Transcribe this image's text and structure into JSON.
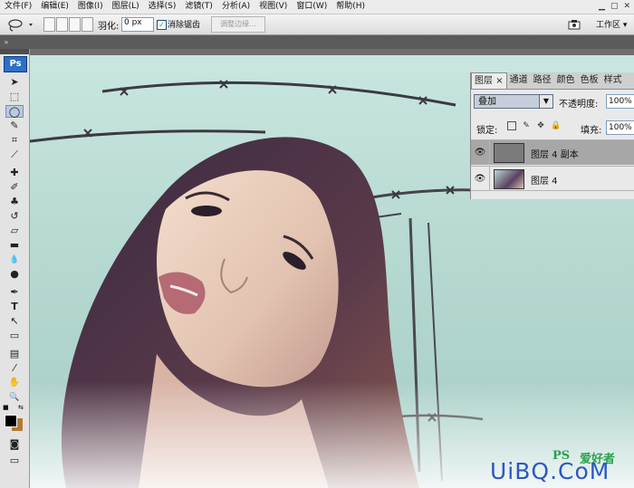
{
  "menu": {
    "items": [
      "文件(F)",
      "编辑(E)",
      "图像(I)",
      "图层(L)",
      "选择(S)",
      "滤镜(T)",
      "分析(A)",
      "视图(V)",
      "窗口(W)",
      "帮助(H)"
    ]
  },
  "options_bar": {
    "feather_label": "羽化:",
    "feather_value": "0 px",
    "antialias_label": "消除锯齿",
    "antialias_checked": true,
    "refine_edge_label": "调整边缘...",
    "workspace_label": "工作区 ▾"
  },
  "toolbox": {
    "logo": "Ps",
    "tools": [
      {
        "name": "move-tool",
        "glyph": "➤"
      },
      {
        "name": "marquee-tool",
        "glyph": "⬚"
      },
      {
        "name": "lasso-tool",
        "glyph": "◯",
        "active": true
      },
      {
        "name": "quick-select-tool",
        "glyph": "✎"
      },
      {
        "name": "crop-tool",
        "glyph": "⌗"
      },
      {
        "name": "eyedropper-tool",
        "glyph": "⟋"
      },
      {
        "name": "healing-tool",
        "glyph": "✚"
      },
      {
        "name": "brush-tool",
        "glyph": "✐"
      },
      {
        "name": "stamp-tool",
        "glyph": "♣"
      },
      {
        "name": "history-brush-tool",
        "glyph": "↺"
      },
      {
        "name": "eraser-tool",
        "glyph": "▱"
      },
      {
        "name": "gradient-tool",
        "glyph": "▬"
      },
      {
        "name": "blur-tool",
        "glyph": "💧"
      },
      {
        "name": "dodge-tool",
        "glyph": "●"
      },
      {
        "name": "pen-tool",
        "glyph": "✒"
      },
      {
        "name": "type-tool",
        "glyph": "T"
      },
      {
        "name": "path-select-tool",
        "glyph": "↖"
      },
      {
        "name": "shape-tool",
        "glyph": "▭"
      },
      {
        "name": "notes-tool",
        "glyph": "▤"
      },
      {
        "name": "eyedropper2-tool",
        "glyph": "⁄"
      },
      {
        "name": "hand-tool",
        "glyph": "✋"
      },
      {
        "name": "zoom-tool",
        "glyph": "🔍"
      }
    ],
    "colors": {
      "foreground": "#000000",
      "background": "#ffffff"
    }
  },
  "layers_panel": {
    "tabs": [
      "图层",
      "通道",
      "路径",
      "颜色",
      "色板",
      "样式"
    ],
    "blend_mode": "叠加",
    "opacity_label": "不透明度:",
    "opacity_value": "100%",
    "lock_label": "锁定:",
    "fill_label": "填充:",
    "fill_value": "100%",
    "layers": [
      {
        "name": "图层 4 副本",
        "selected": true,
        "visible": true
      },
      {
        "name": "图层 4",
        "selected": false,
        "visible": true
      }
    ]
  },
  "watermark": {
    "ps_text": "PS",
    "ps_text2": "爱好者",
    "site": "UiBQ.CoM"
  }
}
